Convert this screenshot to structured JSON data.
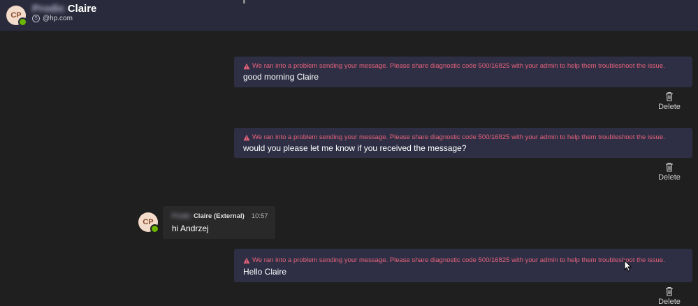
{
  "header": {
    "avatar_initials": "CP",
    "blurred_name": "Prodic",
    "name": "Claire",
    "email": "@hp.com",
    "skype_glyph": "S"
  },
  "messages": [
    {
      "error": "We ran into a problem sending your message. Please share diagnostic code 500/16825 with your admin to help them troubleshoot the issue.",
      "text": "good morning Claire",
      "delete_label": "Delete"
    },
    {
      "error": "We ran into a problem sending your message. Please share diagnostic code 500/16825 with your admin to help them troubleshoot the issue.",
      "text": "would you please let me know if you received the message?",
      "delete_label": "Delete"
    },
    {
      "error": "We ran into a problem sending your message. Please share diagnostic code 500/16825 with your admin to help them troubleshoot the issue.",
      "text": "Hello Claire",
      "delete_label": "Delete"
    }
  ],
  "incoming": {
    "avatar_initials": "CP",
    "blurred_name": "Prodic",
    "sender": "Claire (External)",
    "time": "10:57",
    "text": "hi Andrzej"
  },
  "colors": {
    "background": "#1f1f1f",
    "header": "#292a3b",
    "sent_bubble": "#2e2f45",
    "error_text": "#e8637a",
    "presence": "#6bb700"
  },
  "icons": [
    "warning-icon",
    "trash-icon",
    "presence-available-icon",
    "skype-icon",
    "mouse-cursor-icon"
  ]
}
